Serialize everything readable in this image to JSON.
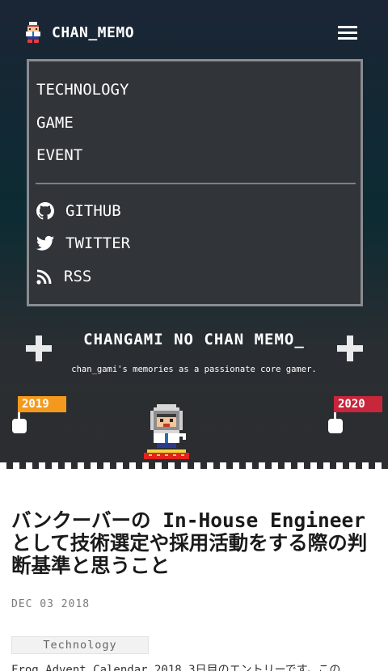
{
  "header": {
    "brand": "CHAN_MEMO",
    "menu_icon": "hamburger-icon"
  },
  "menu": {
    "items": [
      {
        "label": "TECHNOLOGY"
      },
      {
        "label": "GAME"
      },
      {
        "label": "EVENT"
      }
    ],
    "social": [
      {
        "label": "GITHUB",
        "icon": "github-icon"
      },
      {
        "label": "TWITTER",
        "icon": "twitter-icon"
      },
      {
        "label": "RSS",
        "icon": "rss-icon"
      }
    ]
  },
  "hero": {
    "title": "CHANGAMI NO CHAN MEMO_",
    "subtitle": "chan_gami's memories as a passionate core gamer.",
    "flag_left": {
      "label": "2019",
      "color": "#f39a1e"
    },
    "flag_right": {
      "label": "2020",
      "color": "#c8263a"
    }
  },
  "post": {
    "title": "バンクーバーの In-House Engineer として技術選定や採用活動をする際の判断基準と思うこと",
    "date": "DEC 03 2018",
    "tag": "Technology",
    "excerpt": "Frog Advent Calendar 2018 3日目のエントリーです。この"
  }
}
